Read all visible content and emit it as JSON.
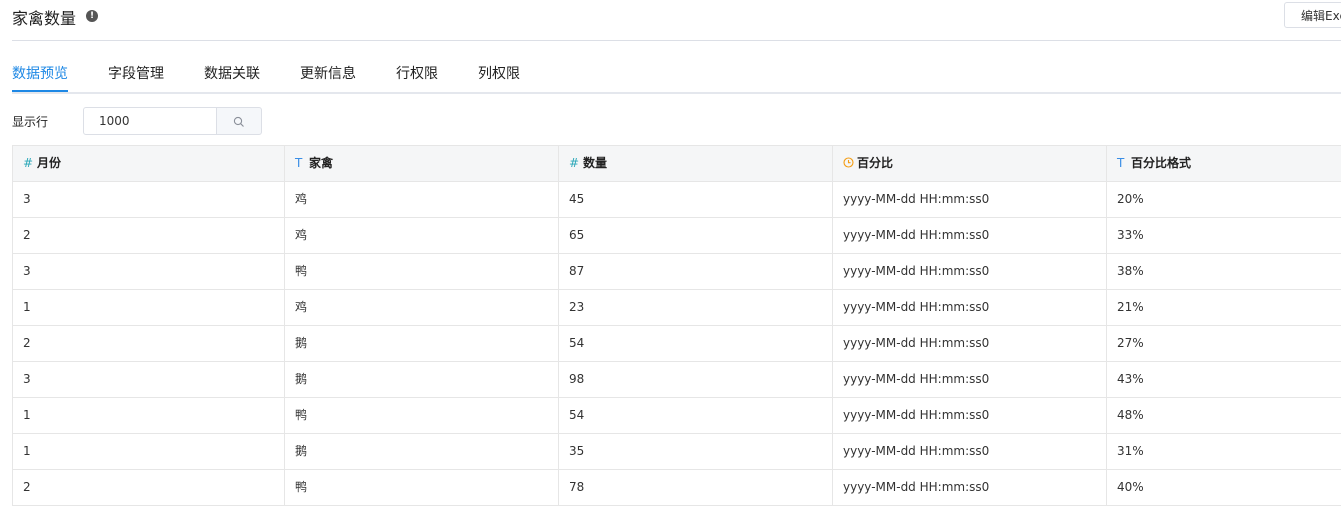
{
  "header": {
    "title": "家禽数量",
    "info_icon": "info-icon",
    "edit_button": "编辑Excel"
  },
  "tabs": [
    {
      "label": "数据预览",
      "active": true
    },
    {
      "label": "字段管理"
    },
    {
      "label": "数据关联"
    },
    {
      "label": "更新信息"
    },
    {
      "label": "行权限"
    },
    {
      "label": "列权限"
    }
  ],
  "toolbar": {
    "rows_label": "显示行",
    "rows_value": "1000",
    "search_icon": "search-icon"
  },
  "table": {
    "columns": [
      {
        "name": "月份",
        "type": "number",
        "icon": "#"
      },
      {
        "name": "家禽",
        "type": "text",
        "icon": "T"
      },
      {
        "name": "数量",
        "type": "number",
        "icon": "#"
      },
      {
        "name": "百分比",
        "type": "date",
        "icon": "clock-icon"
      },
      {
        "name": "百分比格式",
        "type": "text",
        "icon": "T"
      }
    ],
    "rows": [
      [
        "3",
        "鸡",
        "45",
        "yyyy-MM-dd HH:mm:ss0",
        "20%"
      ],
      [
        "2",
        "鸡",
        "65",
        "yyyy-MM-dd HH:mm:ss0",
        "33%"
      ],
      [
        "3",
        "鸭",
        "87",
        "yyyy-MM-dd HH:mm:ss0",
        "38%"
      ],
      [
        "1",
        "鸡",
        "23",
        "yyyy-MM-dd HH:mm:ss0",
        "21%"
      ],
      [
        "2",
        "鹅",
        "54",
        "yyyy-MM-dd HH:mm:ss0",
        "27%"
      ],
      [
        "3",
        "鹅",
        "98",
        "yyyy-MM-dd HH:mm:ss0",
        "43%"
      ],
      [
        "1",
        "鸭",
        "54",
        "yyyy-MM-dd HH:mm:ss0",
        "48%"
      ],
      [
        "1",
        "鹅",
        "35",
        "yyyy-MM-dd HH:mm:ss0",
        "31%"
      ],
      [
        "2",
        "鸭",
        "78",
        "yyyy-MM-dd HH:mm:ss0",
        "40%"
      ]
    ]
  },
  "colors": {
    "accent": "#1e88e5",
    "number_icon": "#2aa7b8",
    "text_icon": "#3a8ee6",
    "date_icon": "#f39c12"
  }
}
